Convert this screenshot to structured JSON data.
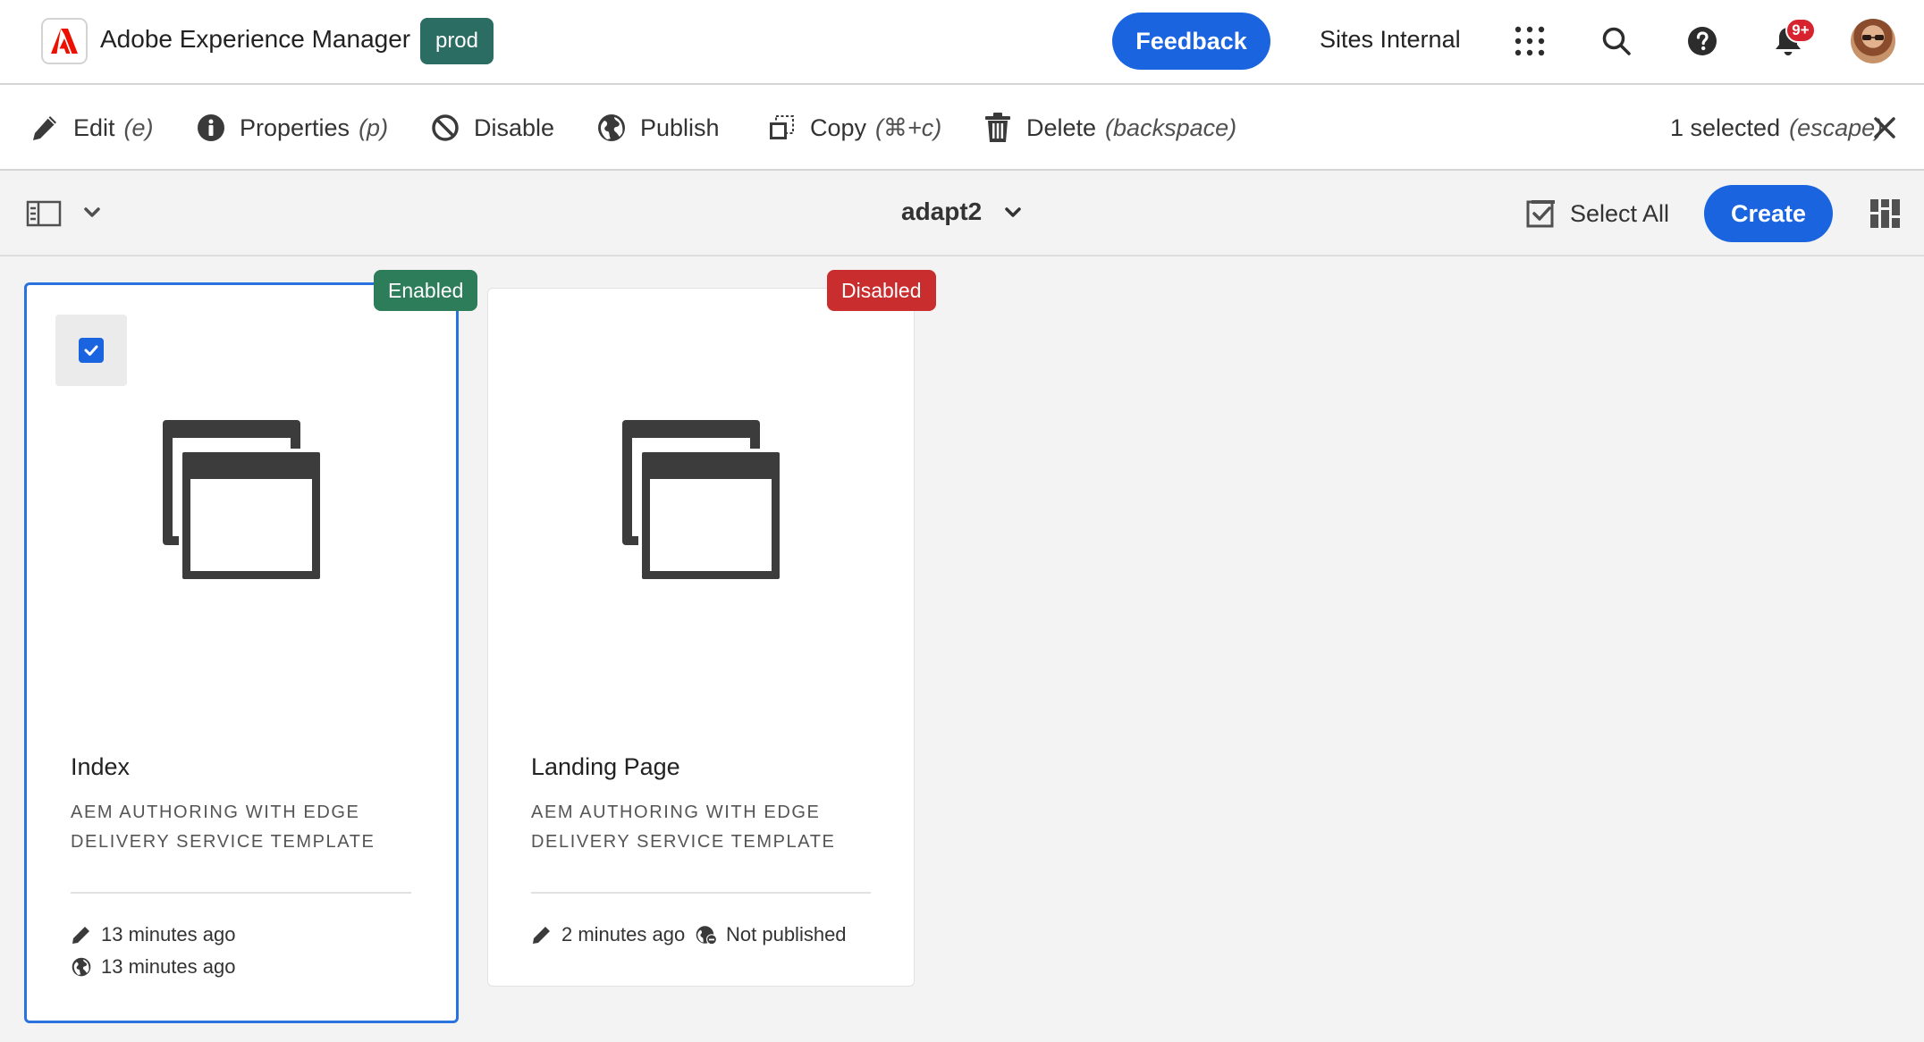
{
  "header": {
    "app_title": "Adobe Experience Manager",
    "env_badge": "prod",
    "feedback_label": "Feedback",
    "org_label": "Sites Internal",
    "notification_count": "9+",
    "icons": [
      "adobe-logo-icon",
      "apps-grid-icon",
      "search-icon",
      "help-icon",
      "bell-icon",
      "avatar"
    ]
  },
  "actions": {
    "items": [
      {
        "label": "Edit",
        "shortcut": "(e)",
        "icon": "pencil-icon"
      },
      {
        "label": "Properties",
        "shortcut": "(p)",
        "icon": "info-icon"
      },
      {
        "label": "Disable",
        "shortcut": "",
        "icon": "disable-icon"
      },
      {
        "label": "Publish",
        "shortcut": "",
        "icon": "globe-icon"
      },
      {
        "label": "Copy",
        "shortcut": "(⌘+c)",
        "icon": "copy-icon"
      },
      {
        "label": "Delete",
        "shortcut": "(backspace)",
        "icon": "trash-icon"
      }
    ],
    "selected_text": "1 selected",
    "selected_shortcut": "(escape)"
  },
  "toolbar": {
    "folder_title": "adapt2",
    "select_all_label": "Select All",
    "create_label": "Create"
  },
  "cards": [
    {
      "title": "Index",
      "status": "Enabled",
      "template_line1": "AEM AUTHORING WITH EDGE",
      "template_line2": "DELIVERY SERVICE TEMPLATE",
      "modified": "13 minutes ago",
      "published": "13 minutes ago",
      "selected": true
    },
    {
      "title": "Landing Page",
      "status": "Disabled",
      "template_line1": "AEM AUTHORING WITH EDGE",
      "template_line2": "DELIVERY SERVICE TEMPLATE",
      "modified": "2 minutes ago",
      "published": "Not published",
      "selected": false
    }
  ],
  "colors": {
    "accent_blue": "#1a64e0",
    "env_badge": "#2b6c63",
    "status_enabled": "#2d7d5a",
    "status_disabled": "#c92d2d",
    "notification": "#d7232e",
    "adobe_red": "#eb1000"
  }
}
